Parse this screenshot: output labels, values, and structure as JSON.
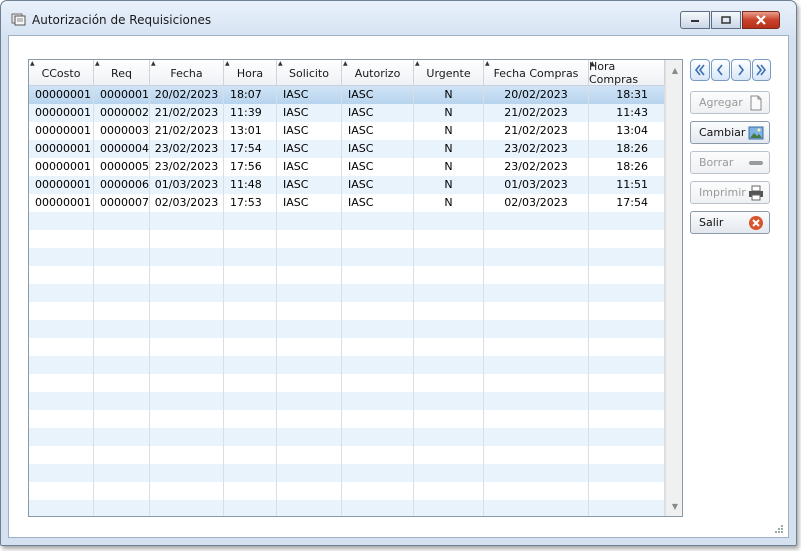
{
  "window": {
    "title": "Autorización de Requisiciones"
  },
  "grid": {
    "columns": [
      {
        "label": "CCosto",
        "align": "left"
      },
      {
        "label": "Req",
        "align": "left"
      },
      {
        "label": "Fecha",
        "align": "center"
      },
      {
        "label": "Hora",
        "align": "left"
      },
      {
        "label": "Solicito",
        "align": "left"
      },
      {
        "label": "Autorizo",
        "align": "left"
      },
      {
        "label": "Urgente",
        "align": "center"
      },
      {
        "label": "Fecha Compras",
        "align": "center"
      },
      {
        "label": "Hora Compras",
        "align": "right"
      }
    ],
    "rows": [
      [
        "00000001",
        "0000001",
        "20/02/2023",
        "18:07",
        "IASC",
        "IASC",
        "N",
        "20/02/2023",
        "18:31"
      ],
      [
        "00000001",
        "0000002",
        "21/02/2023",
        "11:39",
        "IASC",
        "IASC",
        "N",
        "21/02/2023",
        "11:43"
      ],
      [
        "00000001",
        "0000003",
        "21/02/2023",
        "13:01",
        "IASC",
        "IASC",
        "N",
        "21/02/2023",
        "13:04"
      ],
      [
        "00000001",
        "0000004",
        "23/02/2023",
        "17:54",
        "IASC",
        "IASC",
        "N",
        "23/02/2023",
        "18:26"
      ],
      [
        "00000001",
        "0000005",
        "23/02/2023",
        "17:56",
        "IASC",
        "IASC",
        "N",
        "23/02/2023",
        "18:26"
      ],
      [
        "00000001",
        "0000006",
        "01/03/2023",
        "11:48",
        "IASC",
        "IASC",
        "N",
        "01/03/2023",
        "11:51"
      ],
      [
        "00000001",
        "0000007",
        "02/03/2023",
        "17:53",
        "IASC",
        "IASC",
        "N",
        "02/03/2023",
        "17:54"
      ]
    ],
    "selected_row": 0,
    "total_visible_rows": 24
  },
  "actions": {
    "nav": [
      {
        "name": "first-record",
        "icon": "double-chevron-left-icon"
      },
      {
        "name": "previous-record",
        "icon": "chevron-left-icon"
      },
      {
        "name": "next-record",
        "icon": "chevron-right-icon"
      },
      {
        "name": "last-record",
        "icon": "double-chevron-right-icon"
      }
    ],
    "agregar": {
      "label": "Agregar",
      "icon": "document-icon",
      "enabled": false
    },
    "cambiar": {
      "label": "Cambiar",
      "icon": "picture-icon",
      "enabled": true
    },
    "borrar": {
      "label": "Borrar",
      "icon": "minus-icon",
      "enabled": false
    },
    "imprimir": {
      "label": "Imprimir",
      "icon": "printer-icon",
      "enabled": false
    },
    "salir": {
      "label": "Salir",
      "icon": "close-circle-icon",
      "enabled": true
    }
  },
  "colors": {
    "row_alt": "#e9f3fb",
    "row_selected": "#b7d4ee",
    "close_button": "#c9412a",
    "salir_icon": "#d9532c"
  }
}
